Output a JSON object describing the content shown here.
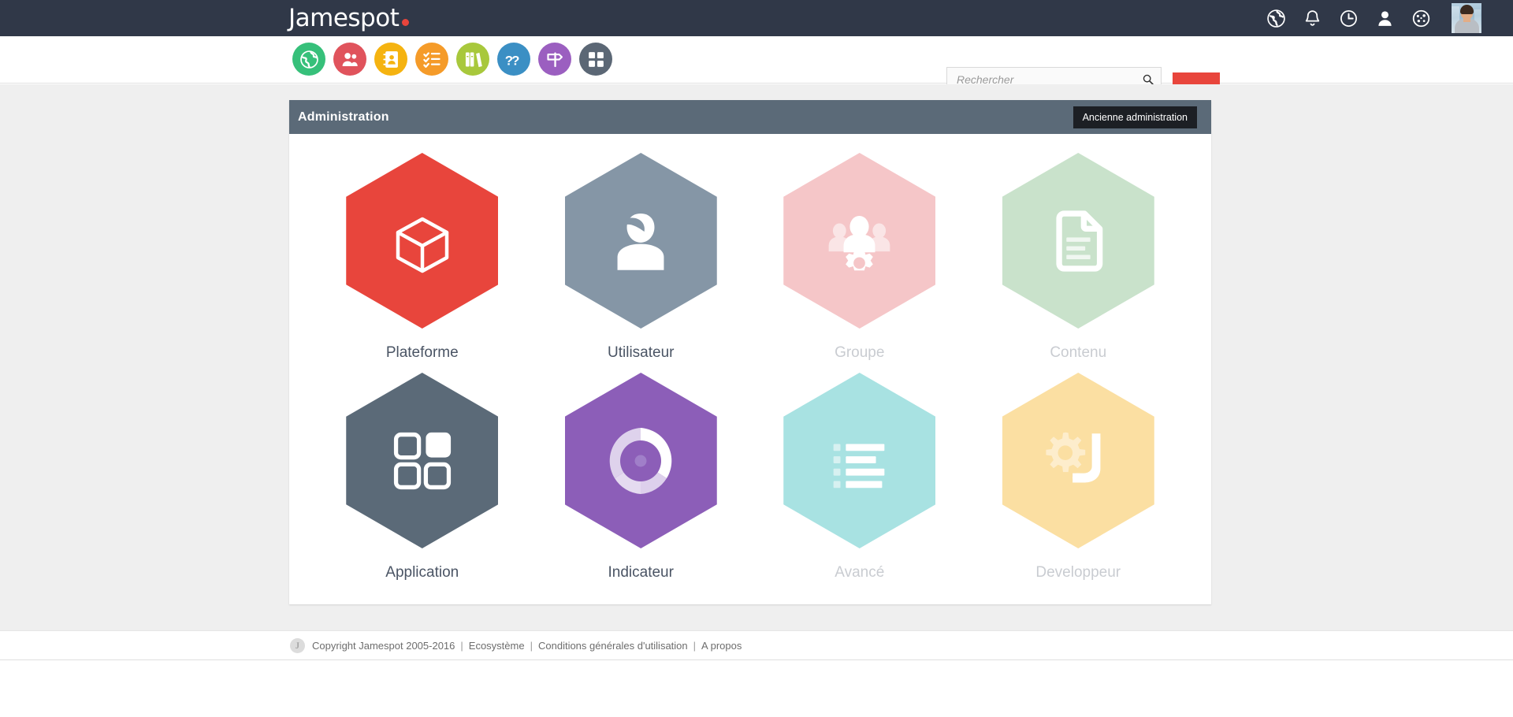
{
  "brand": {
    "name": "Jamespot",
    "dot_color": "#e8453c",
    "topbar_color": "#303848"
  },
  "topbar": {
    "icons": [
      {
        "name": "globe-icon",
        "label": "Réseau"
      },
      {
        "name": "bell-icon",
        "label": "Notifications"
      },
      {
        "name": "clock-icon",
        "label": "Activité récente"
      },
      {
        "name": "user-icon",
        "label": "Profil"
      },
      {
        "name": "dashboard-icon",
        "label": "Tableau de bord"
      }
    ],
    "avatar_label": "Avatar utilisateur"
  },
  "navbar": {
    "app_icons": [
      {
        "name": "globe-app-icon",
        "label": "Réseau",
        "color": "#36c07a"
      },
      {
        "name": "people-app-icon",
        "label": "Communauté",
        "color": "#e0535c"
      },
      {
        "name": "addressbook-app-icon",
        "label": "Annuaire",
        "color": "#f5b310"
      },
      {
        "name": "checklist-app-icon",
        "label": "Tâches",
        "color": "#f59b29"
      },
      {
        "name": "books-app-icon",
        "label": "Documents",
        "color": "#a8c83c"
      },
      {
        "name": "question-app-icon",
        "label": "Questions",
        "color": "#3b8fc4"
      },
      {
        "name": "signpost-app-icon",
        "label": "Idées",
        "color": "#9b5fc0"
      },
      {
        "name": "grid-app-icon",
        "label": "Applications",
        "color": "#5b6775"
      }
    ]
  },
  "search": {
    "placeholder": "Rechercher",
    "value": "",
    "icon": "search-icon"
  },
  "add_button": {
    "label": "+",
    "icon": "plus-icon",
    "color": "#e8453c"
  },
  "panel": {
    "title": "Administration",
    "old_admin_button": "Ancienne administration"
  },
  "tiles": [
    {
      "label": "Plateforme",
      "icon": "cube-icon",
      "color": "#e8453c",
      "disabled": false
    },
    {
      "label": "Utilisateur",
      "icon": "person-icon",
      "color": "#8596a6",
      "disabled": false
    },
    {
      "label": "Groupe",
      "icon": "group-gear-icon",
      "color": "#f5c6c8",
      "disabled": true
    },
    {
      "label": "Contenu",
      "icon": "document-icon",
      "color": "#c9e2cb",
      "disabled": true
    },
    {
      "label": "Application",
      "icon": "app-grid-icon",
      "color": "#5b6a78",
      "disabled": false
    },
    {
      "label": "Indicateur",
      "icon": "donut-chart-icon",
      "color": "#8c5eb8",
      "disabled": false
    },
    {
      "label": "Avancé",
      "icon": "list-icon",
      "color": "#a8e2e2",
      "disabled": true
    },
    {
      "label": "Developpeur",
      "icon": "gear-j-icon",
      "color": "#fbdfa2",
      "disabled": true
    }
  ],
  "footer": {
    "logo_letter": "J",
    "copyright": "Copyright Jamespot 2005-2016",
    "links": [
      "Ecosystème",
      "Conditions générales d'utilisation",
      "A propos"
    ],
    "separator": "|"
  }
}
